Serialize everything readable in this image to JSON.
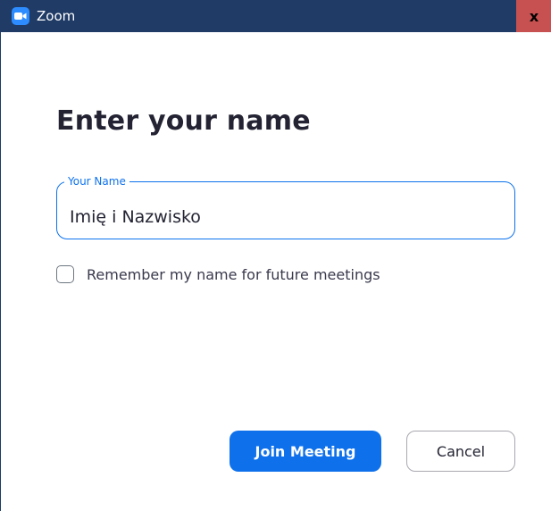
{
  "window": {
    "title": "Zoom",
    "app_icon": "zoom-camera-icon",
    "close_glyph": "x",
    "titlebar_color": "#1f3b66",
    "close_color": "#c75050"
  },
  "dialog": {
    "heading": "Enter your name",
    "name_field": {
      "label": "Your Name",
      "value": "Imię i Nazwisko"
    },
    "remember": {
      "label": "Remember my name for future meetings",
      "checked": false
    },
    "join_label": "Join Meeting",
    "cancel_label": "Cancel",
    "accent_color": "#0e71eb"
  }
}
